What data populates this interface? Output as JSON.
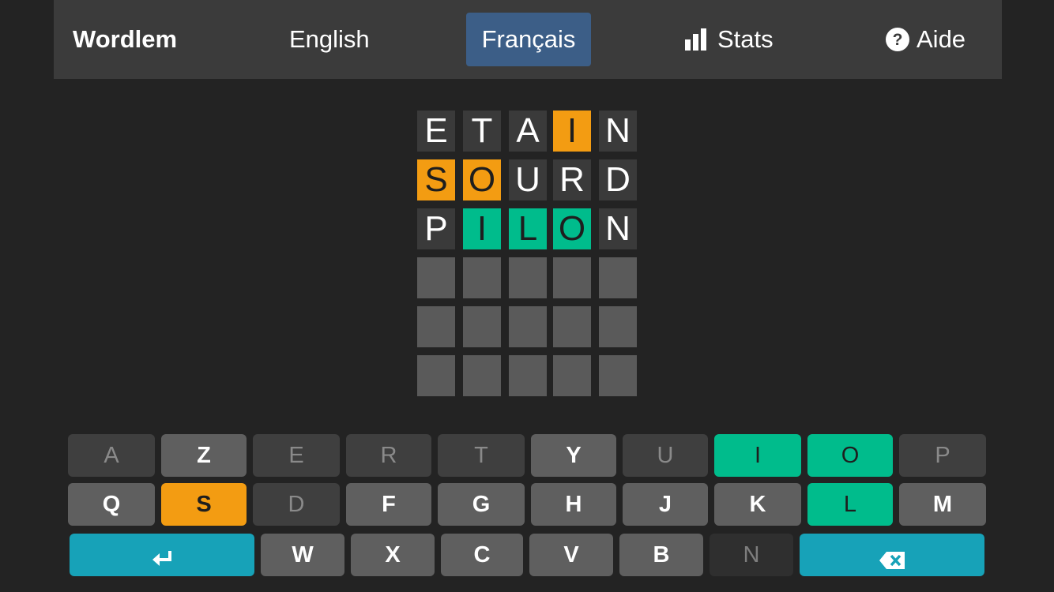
{
  "navbar": {
    "brand": "Wordlem",
    "english": "English",
    "french": "Français",
    "stats": "Stats",
    "help": "Aide",
    "stats_icon": "bar-chart-icon",
    "help_icon": "question-circle-icon"
  },
  "board": {
    "rows": [
      [
        {
          "letter": "E",
          "state": "absent"
        },
        {
          "letter": "T",
          "state": "absent"
        },
        {
          "letter": "A",
          "state": "absent"
        },
        {
          "letter": "I",
          "state": "present"
        },
        {
          "letter": "N",
          "state": "absent"
        }
      ],
      [
        {
          "letter": "S",
          "state": "present"
        },
        {
          "letter": "O",
          "state": "present"
        },
        {
          "letter": "U",
          "state": "absent"
        },
        {
          "letter": "R",
          "state": "absent"
        },
        {
          "letter": "D",
          "state": "absent"
        }
      ],
      [
        {
          "letter": "P",
          "state": "absent"
        },
        {
          "letter": "I",
          "state": "correct"
        },
        {
          "letter": "L",
          "state": "correct"
        },
        {
          "letter": "O",
          "state": "correct"
        },
        {
          "letter": "N",
          "state": "absent"
        }
      ],
      [
        {
          "letter": "",
          "state": "empty"
        },
        {
          "letter": "",
          "state": "empty"
        },
        {
          "letter": "",
          "state": "empty"
        },
        {
          "letter": "",
          "state": "empty"
        },
        {
          "letter": "",
          "state": "empty"
        }
      ],
      [
        {
          "letter": "",
          "state": "empty"
        },
        {
          "letter": "",
          "state": "empty"
        },
        {
          "letter": "",
          "state": "empty"
        },
        {
          "letter": "",
          "state": "empty"
        },
        {
          "letter": "",
          "state": "empty"
        }
      ],
      [
        {
          "letter": "",
          "state": "empty"
        },
        {
          "letter": "",
          "state": "empty"
        },
        {
          "letter": "",
          "state": "empty"
        },
        {
          "letter": "",
          "state": "empty"
        },
        {
          "letter": "",
          "state": "empty"
        }
      ]
    ]
  },
  "keyboard": {
    "rows": [
      [
        {
          "label": "A",
          "state": "absent"
        },
        {
          "label": "Z",
          "state": "unused"
        },
        {
          "label": "E",
          "state": "absent"
        },
        {
          "label": "R",
          "state": "absent"
        },
        {
          "label": "T",
          "state": "absent"
        },
        {
          "label": "Y",
          "state": "unused"
        },
        {
          "label": "U",
          "state": "absent"
        },
        {
          "label": "I",
          "state": "correct"
        },
        {
          "label": "O",
          "state": "correct"
        },
        {
          "label": "P",
          "state": "absent"
        }
      ],
      [
        {
          "label": "Q",
          "state": "unused"
        },
        {
          "label": "S",
          "state": "present"
        },
        {
          "label": "D",
          "state": "absent"
        },
        {
          "label": "F",
          "state": "unused"
        },
        {
          "label": "G",
          "state": "unused"
        },
        {
          "label": "H",
          "state": "unused"
        },
        {
          "label": "J",
          "state": "unused"
        },
        {
          "label": "K",
          "state": "unused"
        },
        {
          "label": "L",
          "state": "correct"
        },
        {
          "label": "M",
          "state": "unused"
        }
      ],
      [
        {
          "label": "",
          "state": "action",
          "icon": "enter-icon"
        },
        {
          "label": "W",
          "state": "unused"
        },
        {
          "label": "X",
          "state": "unused"
        },
        {
          "label": "C",
          "state": "unused"
        },
        {
          "label": "V",
          "state": "unused"
        },
        {
          "label": "B",
          "state": "unused"
        },
        {
          "label": "N",
          "state": "absent-dark"
        },
        {
          "label": "",
          "state": "action",
          "icon": "backspace-icon"
        }
      ]
    ]
  },
  "colors": {
    "present": "#f39c12",
    "correct": "#00bc8c",
    "action": "#17a2b8",
    "active_nav": "#3c5e87"
  }
}
